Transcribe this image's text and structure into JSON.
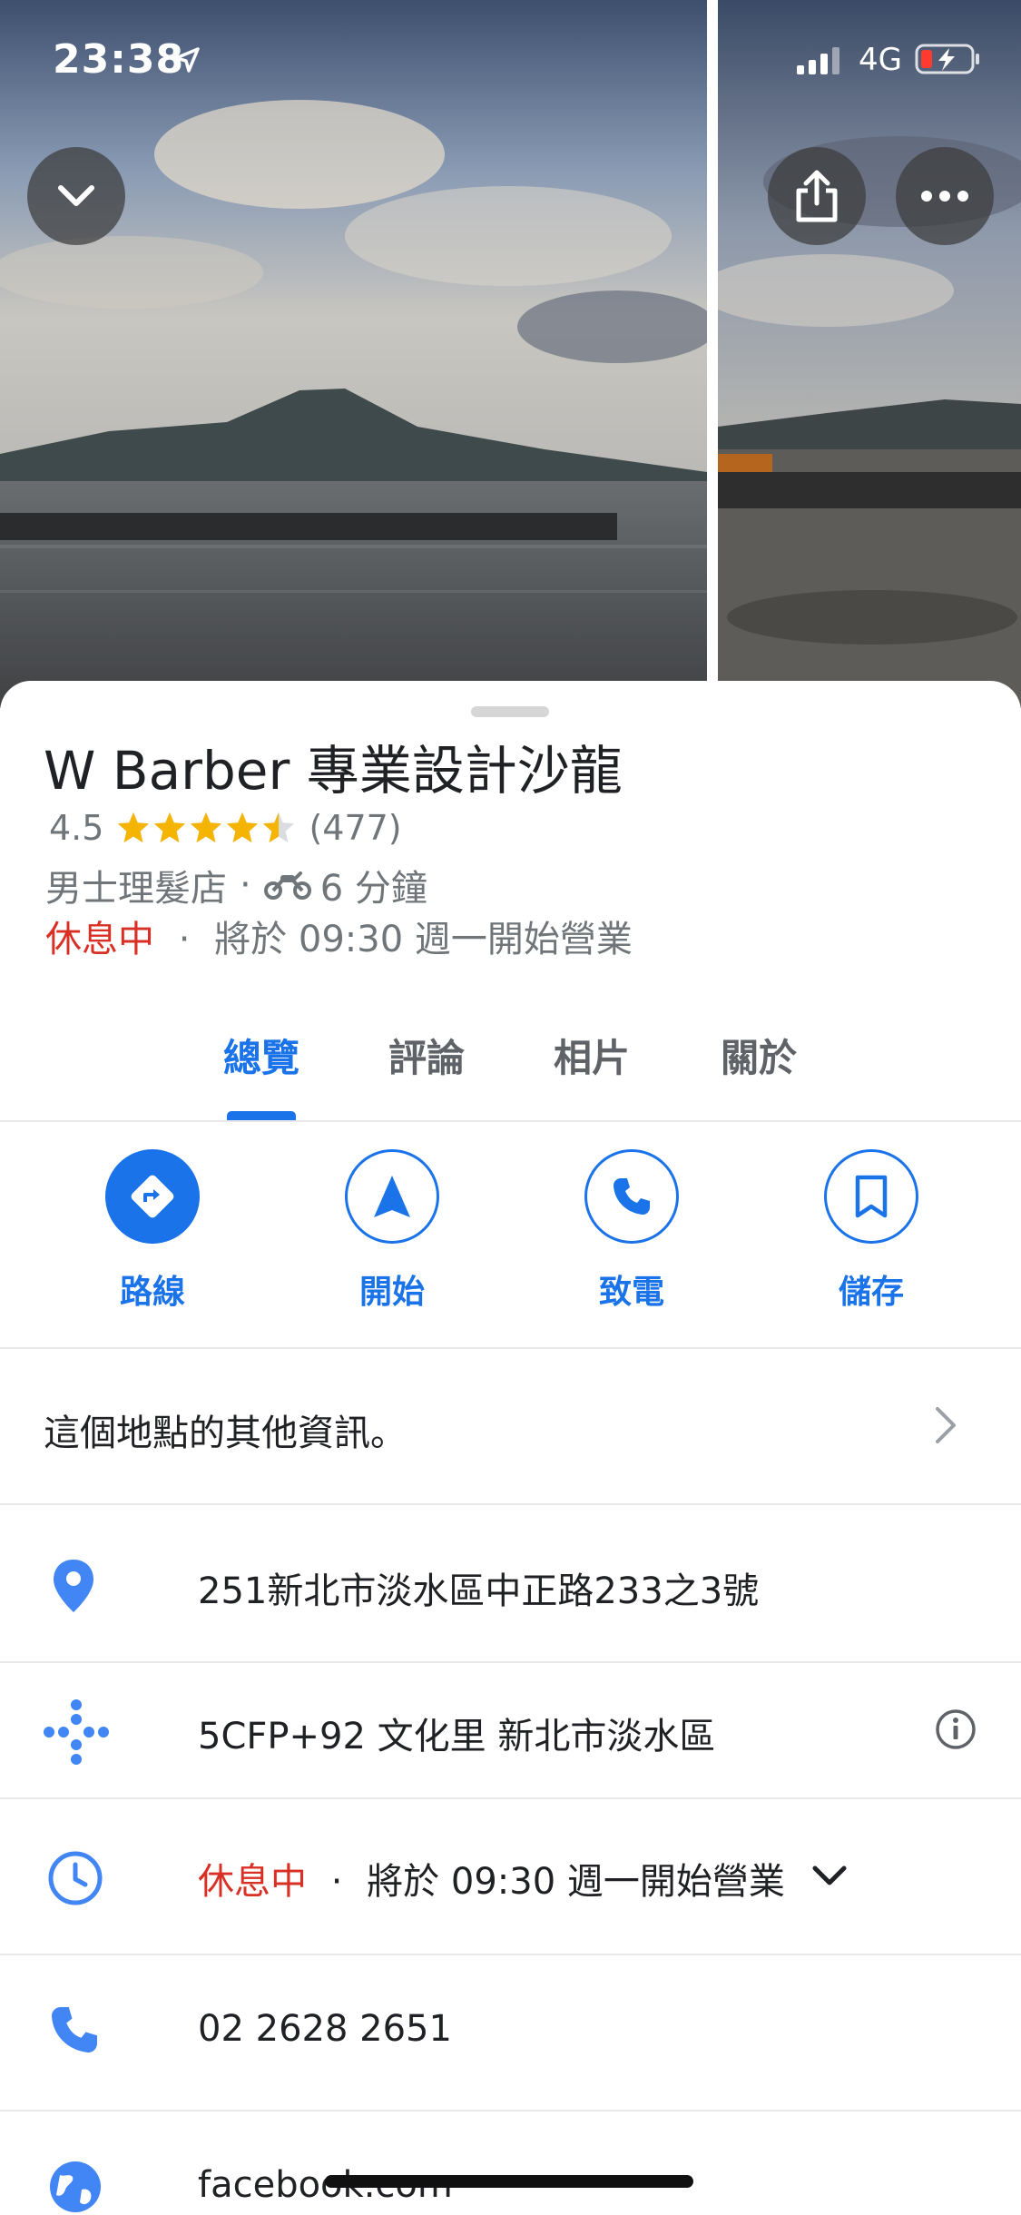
{
  "status_bar": {
    "time": "23:38",
    "network": "4G"
  },
  "header_buttons": {
    "collapse_icon": "chevron-down-icon",
    "share_icon": "share-icon",
    "more_icon": "more-icon"
  },
  "place": {
    "name": "W Barber 專業設計沙龍",
    "rating": "4.5",
    "rating_value": 4.5,
    "review_count": "(477)",
    "category": "男士理髮店",
    "travel_time": "6 分鐘",
    "status": "休息中",
    "opens": "將於 09:30 週一開始營業"
  },
  "separator": "·",
  "tabs": [
    {
      "label": "總覽",
      "active": true
    },
    {
      "label": "評論",
      "active": false
    },
    {
      "label": "相片",
      "active": false
    },
    {
      "label": "關於",
      "active": false
    }
  ],
  "actions": [
    {
      "label": "路線",
      "icon": "directions-icon"
    },
    {
      "label": "開始",
      "icon": "navigation-icon"
    },
    {
      "label": "致電",
      "icon": "phone-icon"
    },
    {
      "label": "儲存",
      "icon": "bookmark-icon"
    }
  ],
  "info": {
    "more_info": "這個地點的其他資訊。",
    "address": "251新北市淡水區中正路233之3號",
    "plus_code": "5CFP+92 文化里 新北市淡水區",
    "hours_status": "休息中",
    "hours_detail": "將於 09:30 週一開始營業",
    "phone": "02 2628 2651",
    "website": "facebook.com"
  },
  "colors": {
    "accent": "#1a73e8",
    "closed": "#d93025",
    "star": "#f4b400"
  }
}
